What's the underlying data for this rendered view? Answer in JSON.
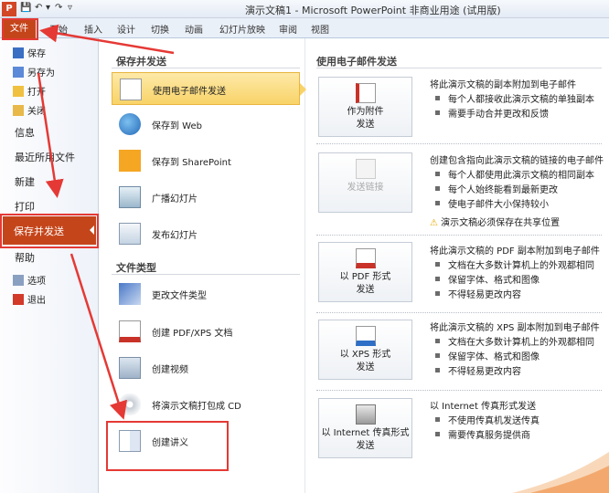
{
  "window": {
    "title": "演示文稿1 - Microsoft PowerPoint 非商业用途 (试用版)"
  },
  "ribbon": {
    "file_tab": "文件",
    "tabs": [
      "开始",
      "插入",
      "设计",
      "切换",
      "动画",
      "幻灯片放映",
      "审阅",
      "视图"
    ]
  },
  "sidebar": {
    "save": "保存",
    "save_as": "另存为",
    "open": "打开",
    "close": "关闭",
    "info": "信息",
    "recent": "最近所用文件",
    "new": "新建",
    "print": "打印",
    "save_send": "保存并发送",
    "help": "帮助",
    "options": "选项",
    "exit": "退出"
  },
  "middle": {
    "section1": "保存并发送",
    "email": "使用电子邮件发送",
    "web": "保存到 Web",
    "sharepoint": "保存到 SharePoint",
    "broadcast": "广播幻灯片",
    "publish": "发布幻灯片",
    "section2": "文件类型",
    "change_type": "更改文件类型",
    "pdf_xps": "创建 PDF/XPS 文档",
    "video": "创建视频",
    "package_cd": "将演示文稿打包成 CD",
    "handouts": "创建讲义"
  },
  "right": {
    "header": "使用电子邮件发送",
    "attach": {
      "btn1": "作为附件",
      "btn2": "发送",
      "desc": "将此演示文稿的副本附加到电子邮件",
      "bullets": [
        "每个人都接收此演示文稿的单独副本",
        "需要手动合并更改和反馈"
      ]
    },
    "link": {
      "btn": "发送链接",
      "desc": "创建包含指向此演示文稿的链接的电子邮件",
      "bullets": [
        "每个人都使用此演示文稿的相同副本",
        "每个人始终能看到最新更改",
        "使电子邮件大小保持较小"
      ],
      "warning": "演示文稿必须保存在共享位置"
    },
    "pdf": {
      "btn1": "以 PDF 形式",
      "btn2": "发送",
      "desc": "将此演示文稿的 PDF 副本附加到电子邮件",
      "bullets": [
        "文档在大多数计算机上的外观都相同",
        "保留字体、格式和图像",
        "不得轻易更改内容"
      ]
    },
    "xps": {
      "btn1": "以 XPS 形式",
      "btn2": "发送",
      "desc": "将此演示文稿的 XPS 副本附加到电子邮件",
      "bullets": [
        "文档在大多数计算机上的外观都相同",
        "保留字体、格式和图像",
        "不得轻易更改内容"
      ]
    },
    "fax": {
      "btn1": "以 Internet 传真形式",
      "btn2": "发送",
      "desc": "以 Internet 传真形式发送",
      "bullets": [
        "不使用传真机发送传真",
        "需要传真服务提供商"
      ]
    }
  }
}
